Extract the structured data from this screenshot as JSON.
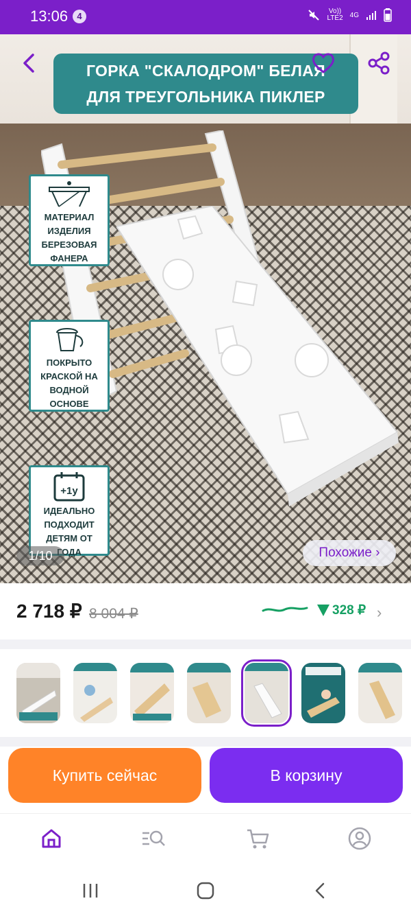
{
  "status_bar": {
    "time": "13:06",
    "notification_count": "4",
    "network_line1": "Vo))",
    "network_line2": "LTE2",
    "network_type": "4G",
    "battery_icon": "battery-icon"
  },
  "hero": {
    "title_line1": "ГОРКА \"СКАЛОДРОМ\" БЕЛАЯ",
    "title_line2": "ДЛЯ ТРЕУГОЛЬНИКА ПИКЛЕР",
    "features": [
      {
        "lines": [
          "МАТЕРИАЛ",
          "ИЗДЕЛИЯ",
          "БЕРЕЗОВАЯ",
          "ФАНЕРА"
        ],
        "icon": "table-icon"
      },
      {
        "lines": [
          "ПОКРЫТО",
          "КРАСКОЙ НА",
          "ВОДНОЙ",
          "ОСНОВЕ"
        ],
        "icon": "paint-bucket-icon"
      },
      {
        "lines": [
          "ИДЕАЛЬНО",
          "ПОДХОДИТ",
          "ДЕТЯМ ОТ",
          "ГОДА"
        ],
        "icon": "calendar-icon",
        "badge": "+1y"
      }
    ],
    "counter": "1/10",
    "similar_label": "Похожие ›"
  },
  "price": {
    "current": "2 718 ₽",
    "old": "8 004 ₽",
    "drop": "328 ₽"
  },
  "thumbnails": {
    "count": 7,
    "active_index": 4
  },
  "actions": {
    "buy_now": "Купить сейчас",
    "add_to_cart": "В корзину"
  },
  "colors": {
    "brand_purple": "#7b1fc9",
    "buy_orange": "#ff8328",
    "cart_purple": "#7b2df0",
    "banner_teal": "#2f8a8c",
    "price_drop_green": "#16a063"
  }
}
